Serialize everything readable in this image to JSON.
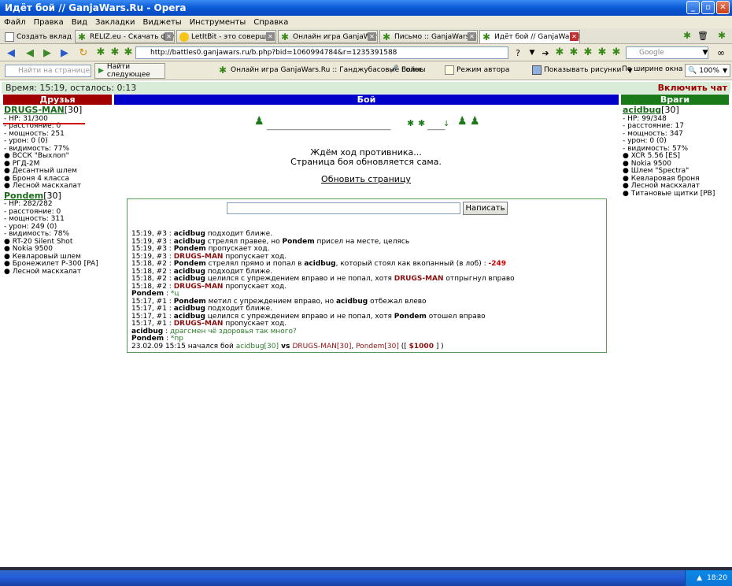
{
  "window": {
    "title": "Идёт бой // GanjaWars.Ru - Opera"
  },
  "menu": [
    "Файл",
    "Правка",
    "Вид",
    "Закладки",
    "Виджеты",
    "Инструменты",
    "Справка"
  ],
  "tabs": [
    {
      "label": "Создать вкладку"
    },
    {
      "label": "RELIZ.eu - Скачать фил..."
    },
    {
      "label": "LetItBit - это совершенн..."
    },
    {
      "label": "Онлайн игра GanjaWars..."
    },
    {
      "label": "Письмо :: GanjaWars.Ru..."
    },
    {
      "label": "Идёт бой // GanjaWars.Ru"
    }
  ],
  "address": {
    "url": "http://battles0.ganjawars.ru/b.php?bid=1060994784&r=1235391588",
    "search_placeholder": "Google"
  },
  "bookmarks": {
    "find_placeholder": "Найти на странице",
    "find_next": "Найти следующее",
    "site": "Онлайн игра GanjaWars.Ru :: Ганджубасовые Войны",
    "voice": "Голос",
    "author_mode": "Режим автора",
    "show_images": "Показывать рисунки",
    "fit_width": "По ширине окна",
    "zoom": "100%"
  },
  "status": {
    "time": "Время: 15:19, осталось: 0:13",
    "chat_toggle": "Включить чат"
  },
  "headers": {
    "friends": "Друзья",
    "battle": "Бой",
    "enemies": "Враги"
  },
  "colors": {
    "friends": "#a00000",
    "battle": "#0000c8",
    "enemies": "#1a7a1a"
  },
  "friends": [
    {
      "name": "DRUGS-MAN",
      "level": "[30]",
      "stats": [
        "- HP: 31/300",
        "- расстояние: 0",
        "- мощность: 251",
        "- урон: 0 (0)",
        "- видимость: 77%"
      ],
      "items": [
        "ВССК \"Выхлоп\"",
        "РГД-2М",
        "Десантный шлем",
        "Броня 4 класса",
        "Лесной маскхалат"
      ]
    },
    {
      "name": "Pondem",
      "level": "[30]",
      "stats": [
        "- HP: 282/282",
        "- расстояние: 0",
        "- мощность: 311",
        "- урон: 249 (0)",
        "- видимость: 78%"
      ],
      "items": [
        "RT-20 Silent Shot",
        "Nokia 9500",
        "Кевларовый шлем",
        "Бронежилет Р-300 [PA]",
        "Лесной маскхалат"
      ]
    }
  ],
  "enemies": [
    {
      "name": "acidbug",
      "level": "[30]",
      "stats": [
        "- HP: 99/348",
        "- расстояние: 17",
        "- мощность: 347",
        "- урон: 0 (0)",
        "- видимость: 57%"
      ],
      "items": [
        "XCR 5.56 [ES]",
        "Nokia 9500",
        "Шлем \"Spectra\"",
        "Кевларовая броня",
        "Лесной маскхалат",
        "Титановые щитки [PB]"
      ]
    }
  ],
  "battle": {
    "dots_left": "___________________________________",
    "dots_right": "_____",
    "wait_line1": "Ждём ход противника...",
    "wait_line2": "Страница боя обновляется сама.",
    "refresh": "Обновить страницу"
  },
  "log": {
    "send_button": "Написать",
    "lines": [
      [
        "15:19, #3 : ",
        "acidbug",
        " подходит ближе."
      ],
      [
        "15:19, #3 : ",
        "acidbug",
        " стрелял правее, но ",
        "Pondem",
        " присел на месте, целясь"
      ],
      [
        "15:19, #3 : ",
        "Pondem",
        " пропускает ход."
      ],
      [
        "15:19, #3 : ",
        "DRUGS-MAN",
        " пропускает ход."
      ],
      [
        "15:18, #2 : ",
        "Pondem",
        " стрелял прямо и попал в ",
        "acidbug",
        ", который стоял как вкопанный (в лоб) : ",
        "-249"
      ],
      [
        "15:18, #2 : ",
        "acidbug",
        " подходит ближе."
      ],
      [
        "15:18, #2 : ",
        "acidbug",
        " целился с упреждением вправо и не попал, хотя ",
        "DRUGS-MAN",
        " отпрыгнул вправо"
      ],
      [
        "15:18, #2 : ",
        "DRUGS-MAN",
        " пропускает ход."
      ],
      [
        "",
        "Pondem",
        " : ",
        "*ц"
      ],
      [
        "15:17, #1 : ",
        "Pondem",
        " метил с упреждением вправо, но ",
        "acidbug",
        " отбежал влево"
      ],
      [
        "15:17, #1 : ",
        "acidbug",
        " подходит ближе."
      ],
      [
        "15:17, #1 : ",
        "acidbug",
        " целился с упреждением вправо и не попал, хотя ",
        "Pondem",
        " отошел вправо"
      ],
      [
        "15:17, #1 : ",
        "DRUGS-MAN",
        " пропускает ход."
      ],
      [
        "",
        "acidbug",
        " : ",
        "драгсмен чё здоровья так много?"
      ],
      [
        "",
        "Pondem",
        " : ",
        "*пр"
      ],
      [
        "23.02.09 15:15 начался бой ",
        "acidbug[30]",
        " vs ",
        "DRUGS-MAN[30]",
        ", ",
        "Pondem[30]",
        " ([ ",
        "$1000",
        " ] )"
      ]
    ]
  },
  "tray": {
    "time": "18:20"
  }
}
